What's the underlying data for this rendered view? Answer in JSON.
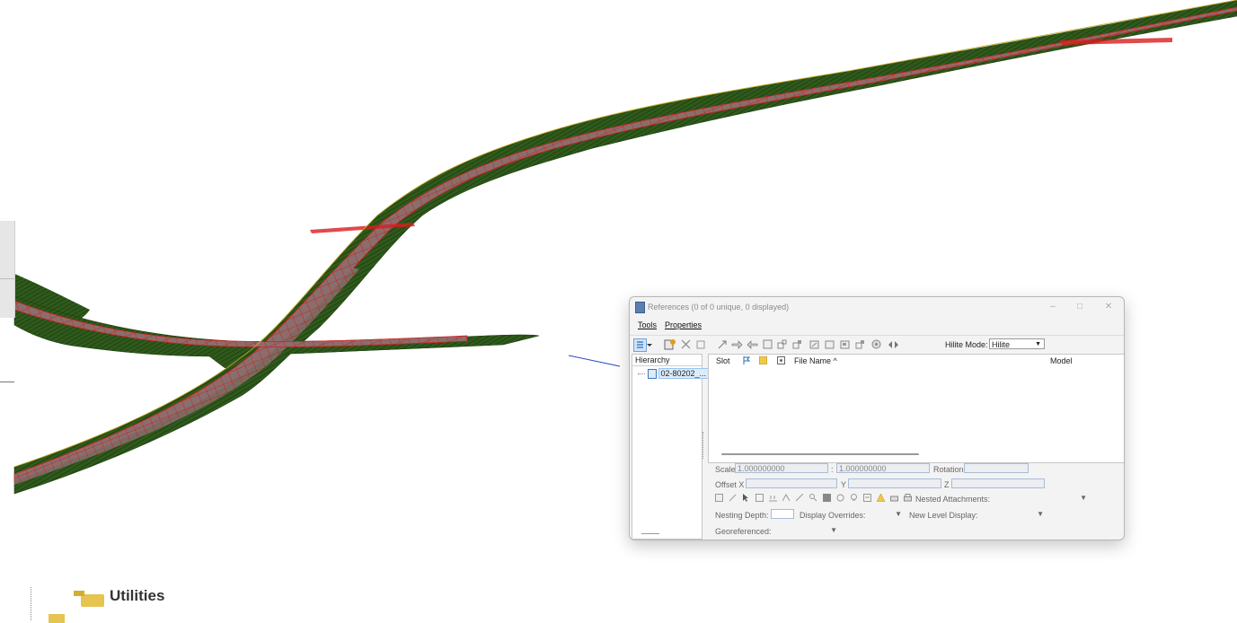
{
  "sidebar": {
    "visible_item": "Utilities"
  },
  "references_dialog": {
    "title": "References (0 of 0 unique, 0 displayed)",
    "window_buttons": {
      "minimize": "–",
      "maximize": "□",
      "close": "✕"
    },
    "menu": {
      "tools": "Tools",
      "properties": "Properties"
    },
    "toolbar": {
      "hilite_mode_label": "Hilite Mode:",
      "hilite_mode_value": "Hilite"
    },
    "hierarchy": {
      "header": "Hierarchy",
      "items": [
        "02-80202_..."
      ]
    },
    "table": {
      "columns": {
        "slot": "Slot",
        "file_name": "File Name",
        "sort_indicator": "^",
        "model": "Model"
      },
      "rows": []
    },
    "properties": {
      "scale_label": "Scale",
      "scale_value_1": "1.000000000",
      "scale_separator": ":",
      "scale_value_2": "1.000000000",
      "rotation_label": "Rotation",
      "rotation_value": "",
      "offset_x_label": "Offset X",
      "offset_x_value": "",
      "y_label": "Y",
      "y_value": "",
      "z_label": "Z",
      "z_value": "",
      "nested_attachments_label": "Nested Attachments:",
      "nested_attachments_value": "",
      "nesting_depth_label": "Nesting Depth:",
      "nesting_depth_value": "",
      "display_overrides_label": "Display Overrides:",
      "display_overrides_value": "",
      "new_level_display_label": "New Level Display:",
      "new_level_display_value": "",
      "georeferenced_label": "Georeferenced:",
      "georeferenced_value": ""
    }
  },
  "colors": {
    "road_surface": "#7a5a5a",
    "road_lines": "#d81e1e",
    "embankment": "#2f5a1c",
    "embankment_dark": "#1d3d10",
    "edge_yellow": "#d8b32a",
    "leader_line": "#2a45c8",
    "hilite_blue": "#cfe3f7"
  }
}
